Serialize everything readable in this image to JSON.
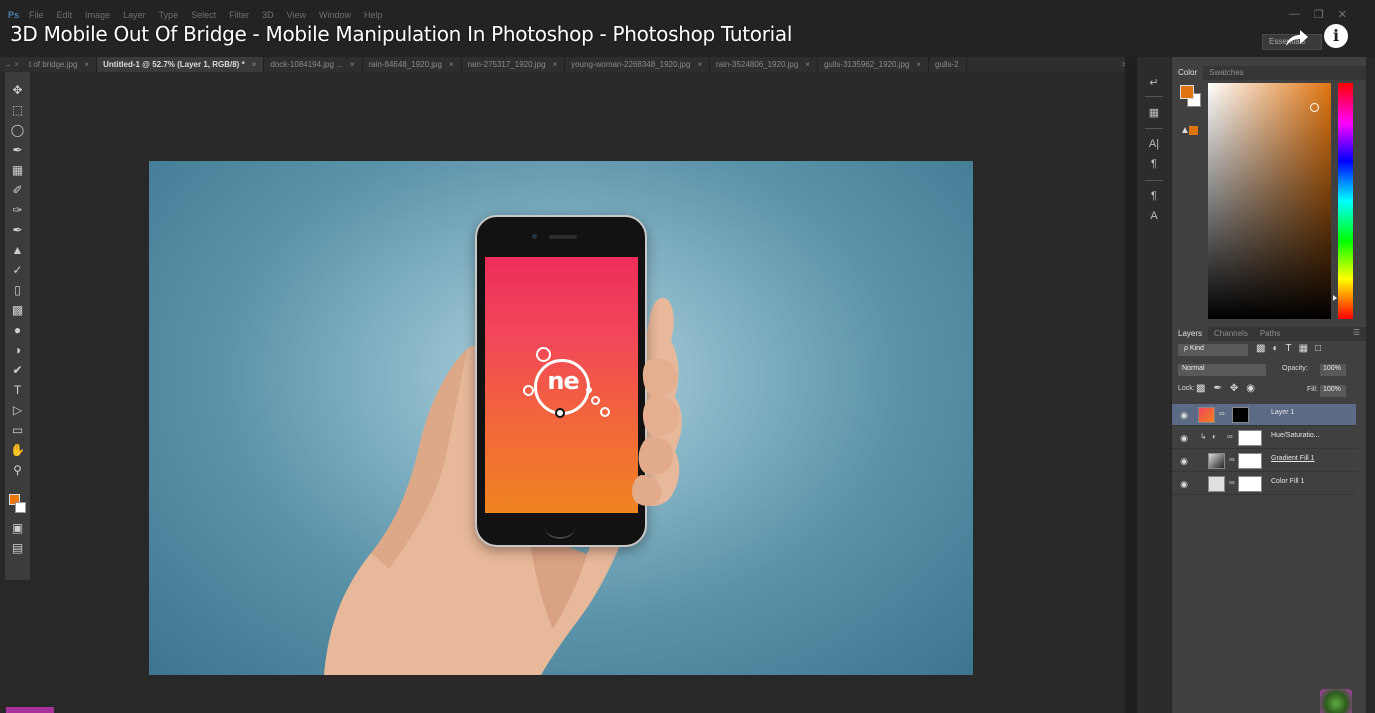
{
  "video": {
    "title": "3D Mobile Out Of Bridge - Mobile Manipulation In Photoshop - Photoshop Tutorial"
  },
  "menu": {
    "app_logo": "Ps",
    "items": [
      "File",
      "Edit",
      "Image",
      "Layer",
      "Type",
      "Select",
      "Filter",
      "3D",
      "View",
      "Window",
      "Help"
    ]
  },
  "workspace": {
    "label": "Essentials"
  },
  "tabs": {
    "lead": "↔ ×",
    "items": [
      {
        "label": "t of bridge.jpg",
        "active": false
      },
      {
        "label": "Untitled-1 @ 52.7% (Layer 1, RGB/8) *",
        "active": true
      },
      {
        "label": "dock-1084194.jpg ...",
        "active": false
      },
      {
        "label": "rain-84648_1920.jpg",
        "active": false
      },
      {
        "label": "rain-275317_1920.jpg",
        "active": false
      },
      {
        "label": "young-woman-2268348_1920.jpg",
        "active": false
      },
      {
        "label": "rain-3524806_1920.jpg",
        "active": false
      },
      {
        "label": "gulls-3135962_1920.jpg",
        "active": false
      },
      {
        "label": "gulls-2",
        "active": false
      }
    ],
    "more": ">>",
    "close": "×"
  },
  "screen": {
    "logo_text": "ne"
  },
  "color_panel": {
    "tabs": [
      "Color",
      "Swatches"
    ],
    "foreground": "#e07410",
    "background": "#ffffff"
  },
  "layers_panel": {
    "tabs": [
      "Layers",
      "Channels",
      "Paths"
    ],
    "kind": "ρ Kind",
    "blend_mode": "Normal",
    "opacity_label": "Opacity:",
    "opacity": "100%",
    "lock_label": "Lock:",
    "fill_label": "Fill:",
    "fill": "100%",
    "layers": [
      {
        "name": "Layer 1",
        "selected": true
      },
      {
        "name": "Hue/Saturatio...",
        "selected": false
      },
      {
        "name": "Gradient Fill 1",
        "selected": false
      },
      {
        "name": "Color Fill 1",
        "selected": false
      }
    ]
  },
  "colors": {
    "accent_orange": "#e07410",
    "selection_blue": "#5c6a85",
    "panel_bg": "#404040"
  }
}
